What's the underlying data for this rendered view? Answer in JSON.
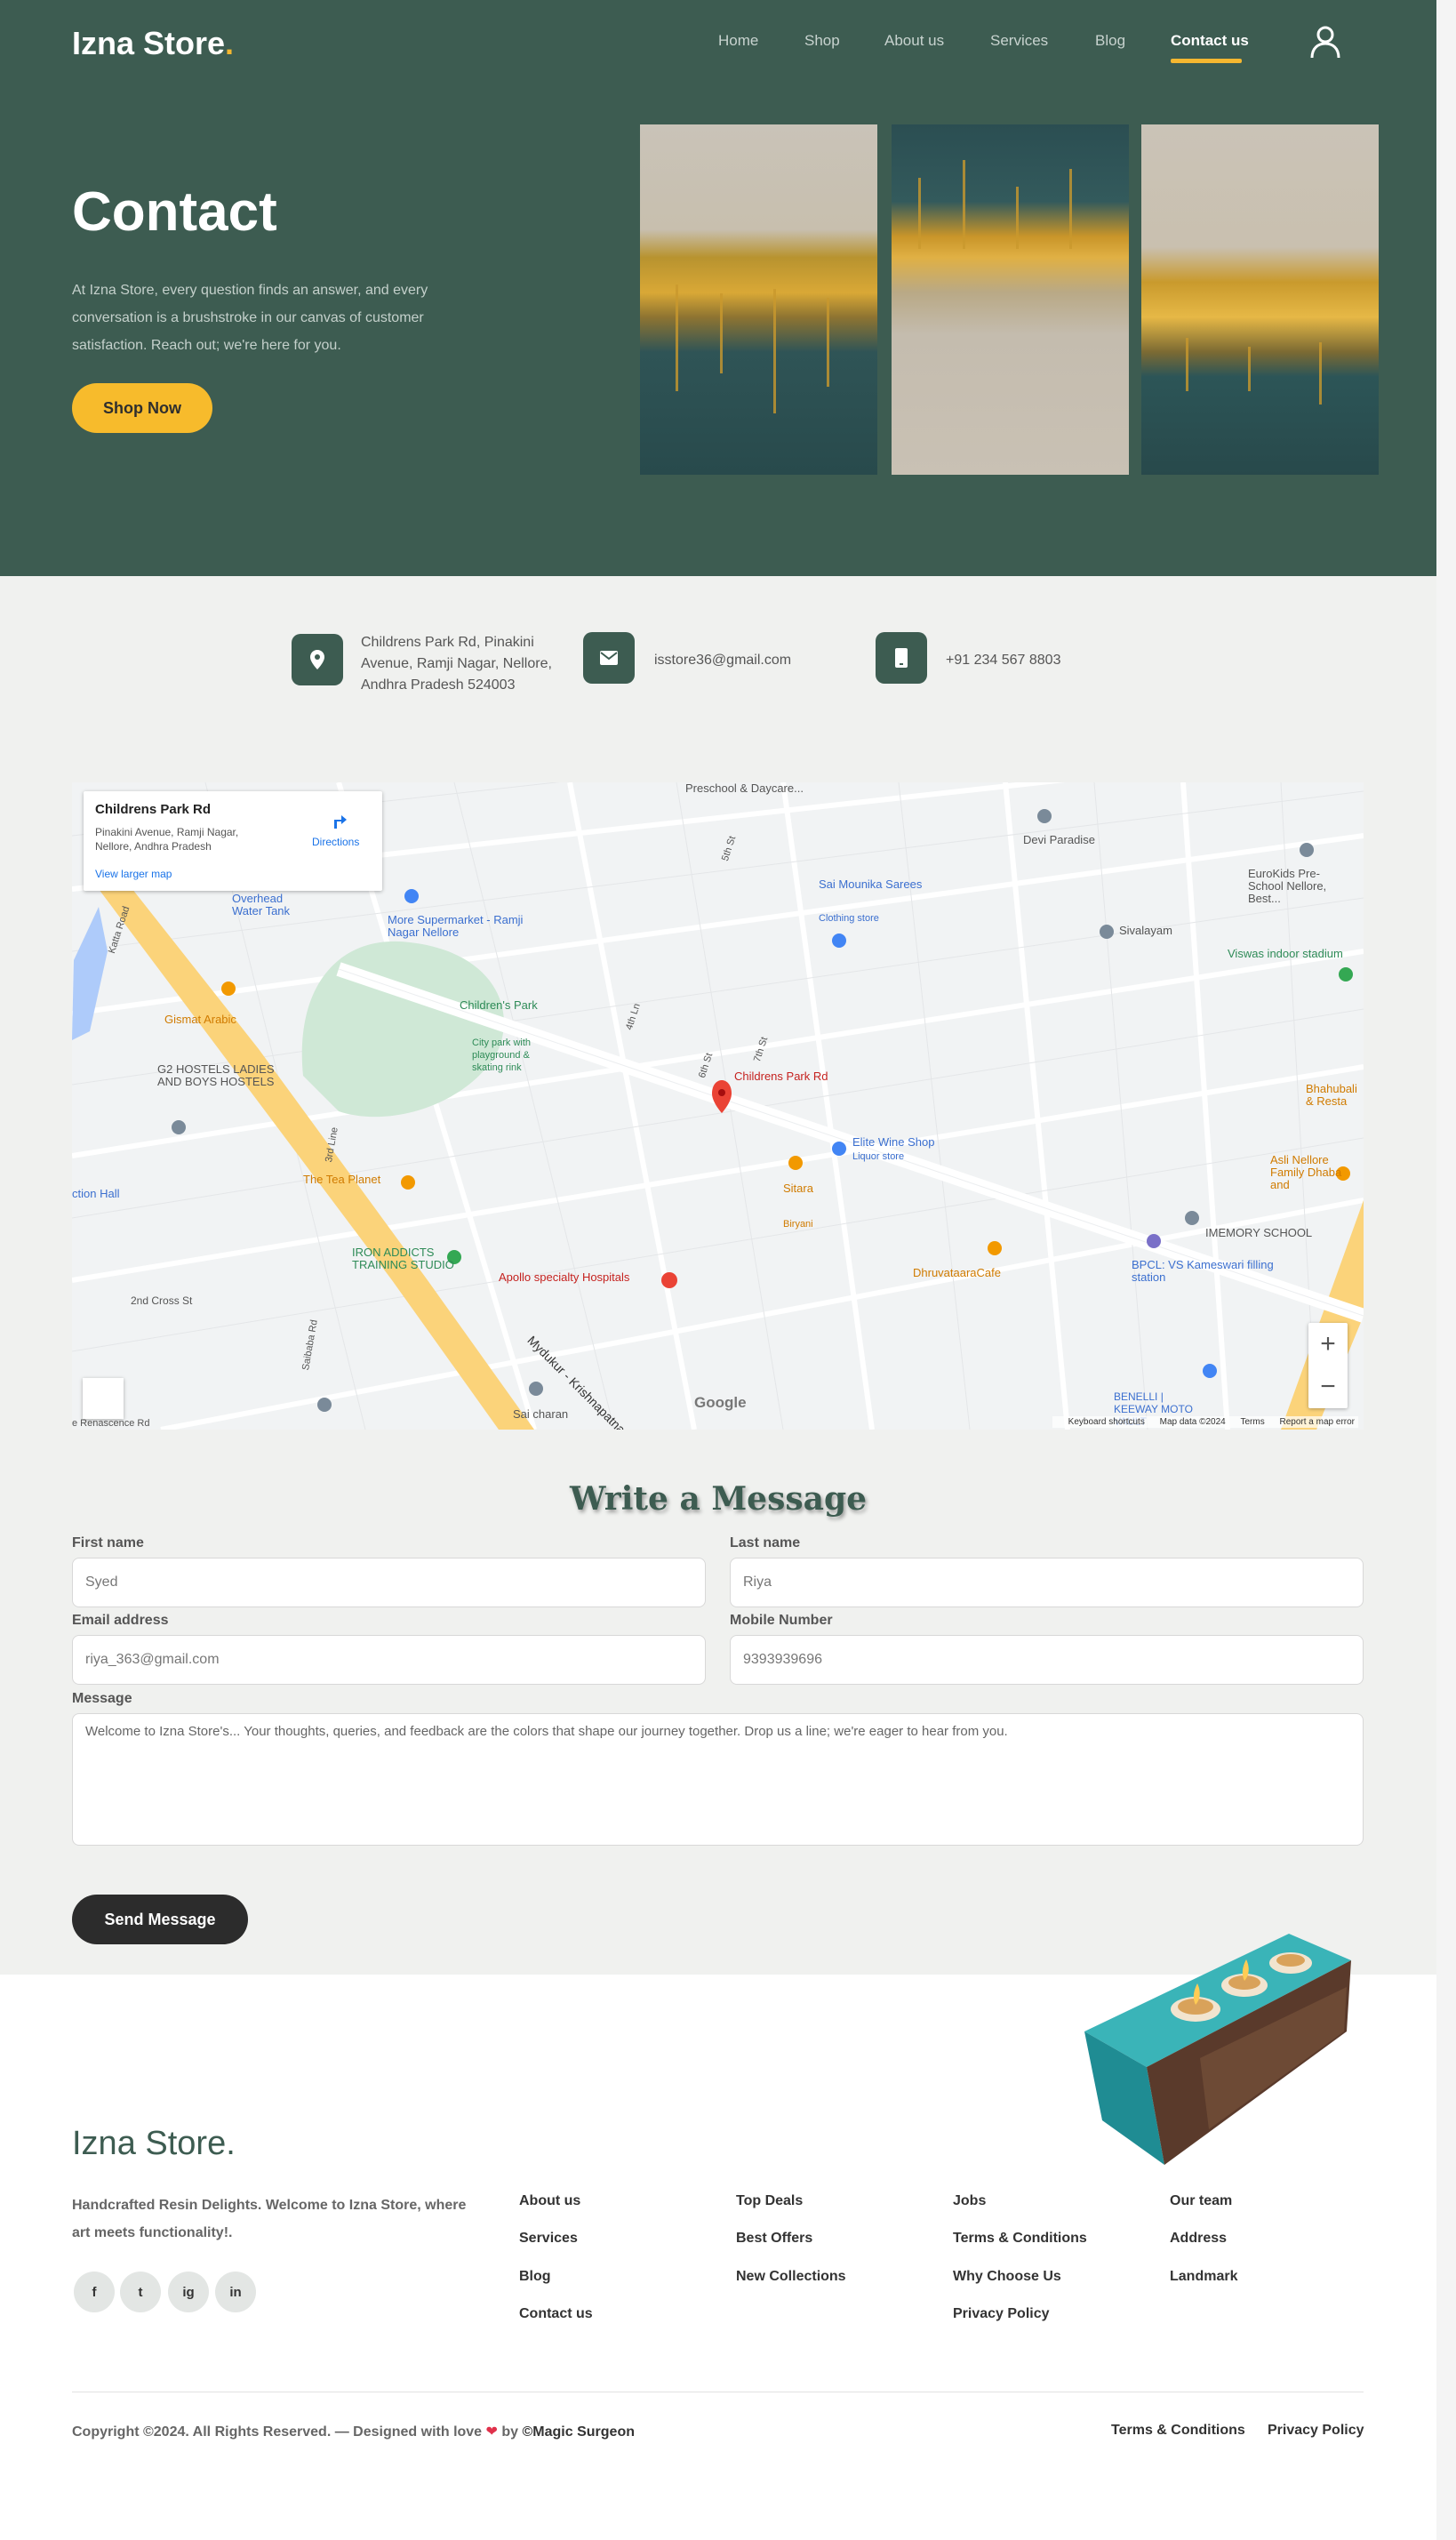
{
  "brand": {
    "name": "Izna Store",
    "dot": ".",
    "accent": "#f5b730",
    "primary": "#3d5c51"
  },
  "nav": {
    "items": [
      "Home",
      "Shop",
      "About us",
      "Services",
      "Blog",
      "Contact us"
    ],
    "active": "Contact us"
  },
  "hero": {
    "title": "Contact",
    "text": "At Izna Store, every question finds an answer, and every conversation is a brushstroke in our canvas of customer satisfaction. Reach out; we're here for you.",
    "button": "Shop Now"
  },
  "contact_info": {
    "address": "Childrens Park Rd, Pinakini Avenue, Ramji Nagar, Nellore, Andhra Pradesh 524003",
    "email": "isstore36@gmail.com",
    "phone": "+91 234 567 8803"
  },
  "map": {
    "place_title": "Childrens Park Rd",
    "place_address": "Pinakini Avenue, Ramji Nagar, Nellore, Andhra Pradesh",
    "directions": "Directions",
    "larger_map": "View larger map",
    "labels": {
      "preschool": "Preschool & Daycare...",
      "devi": "Devi Paradise",
      "eurokids": "EuroKids Pre-School Nellore, Best...",
      "overhead": "Overhead Water Tank",
      "supermarket": "More Supermarket - Ramji Nagar Nellore",
      "saree": "Sai Mounika Sarees",
      "clothing": "Clothing store",
      "sivalayam": "Sivalayam",
      "viswas": "Viswas indoor stadium",
      "childpark": "Children's Park",
      "citypark": "City park with playground & skating rink",
      "gismat": "Gismat Arabic",
      "g2": "G2 HOSTELS LADIES AND BOYS HOSTELS",
      "marker": "Childrens Park Rd",
      "bhahubali": "Bhahubali & Resta",
      "elite": "Elite Wine Shop",
      "liquor": "Liquor store",
      "asli": "Asli Nellore Family Dhaba and",
      "teaplanet": "The Tea Planet",
      "sitara": "Sitara",
      "biryani": "Biryani",
      "memory": "IMEMORY SCHOOL",
      "action": "ction Hall",
      "iron": "IRON ADDICTS TRAINING STUDIO",
      "apollo": "Apollo specialty Hospitals",
      "dhruva": "DhruvataaraCafe",
      "bpcl": "BPCL: VS Kameswari filling station",
      "cross": "2nd Cross St",
      "mydukur": "Mydukur - Krishnapatnam",
      "saicharan": "Sai charan",
      "benelli": "BENELLI | KEEWAY MOTO VAULT",
      "renascence": "e Renascence Rd",
      "katta": "Katta Road",
      "saibaba": "Saibaba Rd",
      "thirdline": "3rd Line",
      "street5": "5th St",
      "street4": "4th Ln",
      "street6": "6th St",
      "street7": "7th St"
    },
    "google": "Google",
    "footer_links": [
      "Keyboard shortcuts",
      "Map data ©2024",
      "Terms",
      "Report a map error"
    ]
  },
  "form": {
    "title": "Write a Message",
    "first_name_label": "First name",
    "first_name_placeholder": "Syed",
    "last_name_label": "Last name",
    "last_name_placeholder": "Riya",
    "email_label": "Email address",
    "email_placeholder": "riya_363@gmail.com",
    "mobile_label": "Mobile Number",
    "mobile_placeholder": "9393939696",
    "message_label": "Message",
    "message_placeholder": "Welcome to Izna Store's... Your thoughts, queries, and feedback are the colors that shape our journey together. Drop us a line; we're eager to hear from you.",
    "send": "Send Message"
  },
  "footer": {
    "logo": "Izna Store.",
    "description": "Handcrafted Resin Delights. Welcome to Izna Store, where art meets functionality!.",
    "social": [
      "f",
      "t",
      "ig",
      "in"
    ],
    "col1": [
      "About us",
      "Services",
      "Blog",
      "Contact us"
    ],
    "col2": [
      "Top Deals",
      "Best Offers",
      "New Collections"
    ],
    "col3": [
      "Jobs",
      "Terms & Conditions",
      "Why Choose Us",
      "Privacy Policy"
    ],
    "col4": [
      "Our team",
      "Address",
      "Landmark"
    ],
    "copyright": "Copyright ©2024. All Rights Reserved. — Designed with love",
    "by": "by",
    "designer": "©Magic Surgeon",
    "bottom_links": [
      "Terms & Conditions",
      "Privacy Policy"
    ]
  }
}
